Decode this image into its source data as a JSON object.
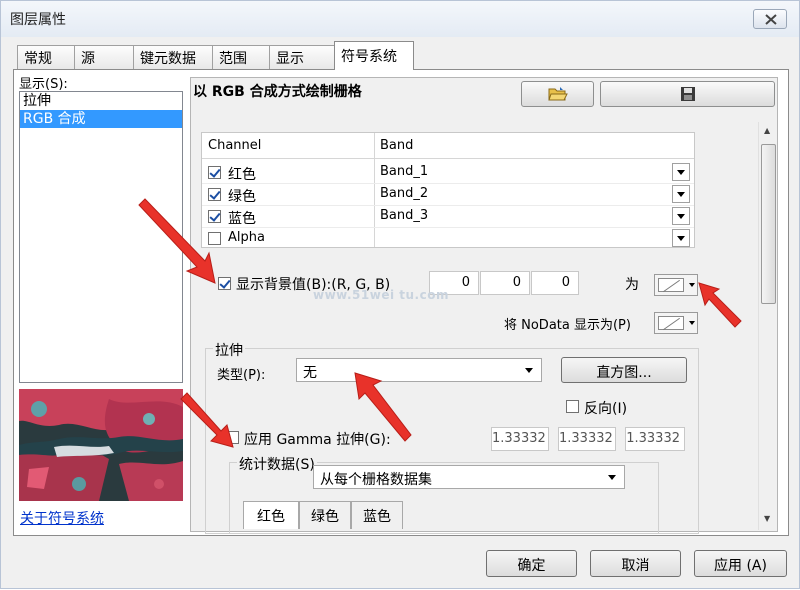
{
  "window": {
    "title": "图层属性"
  },
  "tabs": [
    {
      "label": "常规"
    },
    {
      "label": "源"
    },
    {
      "label": "键元数据"
    },
    {
      "label": "范围"
    },
    {
      "label": "显示"
    },
    {
      "label": "符号系统"
    }
  ],
  "left": {
    "show_label": "显示(S):",
    "list_items": [
      {
        "label": "拉伸"
      },
      {
        "label": "RGB 合成"
      }
    ],
    "about_link": "关于符号系统"
  },
  "panel": {
    "heading": "以 RGB 合成方式绘制栅格",
    "grid": {
      "col_channel": "Channel",
      "col_band": "Band",
      "rows": [
        {
          "channel": "红色",
          "band": "Band_1",
          "checked": true
        },
        {
          "channel": "绿色",
          "band": "Band_2",
          "checked": true
        },
        {
          "channel": "蓝色",
          "band": "Band_3",
          "checked": true
        },
        {
          "channel": "Alpha",
          "band": "",
          "checked": false
        }
      ]
    },
    "background": {
      "label": "显示背景值(B):(R, G, B)",
      "checked": true,
      "r": "0",
      "g": "0",
      "b": "0",
      "as_label": "为"
    },
    "nodata_label": "将 NoData 显示为(P)",
    "watermark": "www.51wei tu.com",
    "stretch": {
      "group_label": "拉伸",
      "type_label": "类型(P):",
      "type_value": "无",
      "histogram_button": "直方图...",
      "invert_label": "反向(I)",
      "gamma_label": "应用 Gamma 拉伸(G):",
      "gamma_values": [
        "1.33332",
        "1.33332",
        "1.33332"
      ],
      "stats_label": "统计数据(S)",
      "stats_value": "从每个栅格数据集",
      "sub_tabs": [
        "红色",
        "绿色",
        "蓝色"
      ]
    }
  },
  "footer": {
    "ok": "确定",
    "cancel": "取消",
    "apply": "应用 (A)"
  },
  "colors": {
    "selection": "#3399ff",
    "arrow": "#e8322a",
    "link": "#0033cc"
  }
}
